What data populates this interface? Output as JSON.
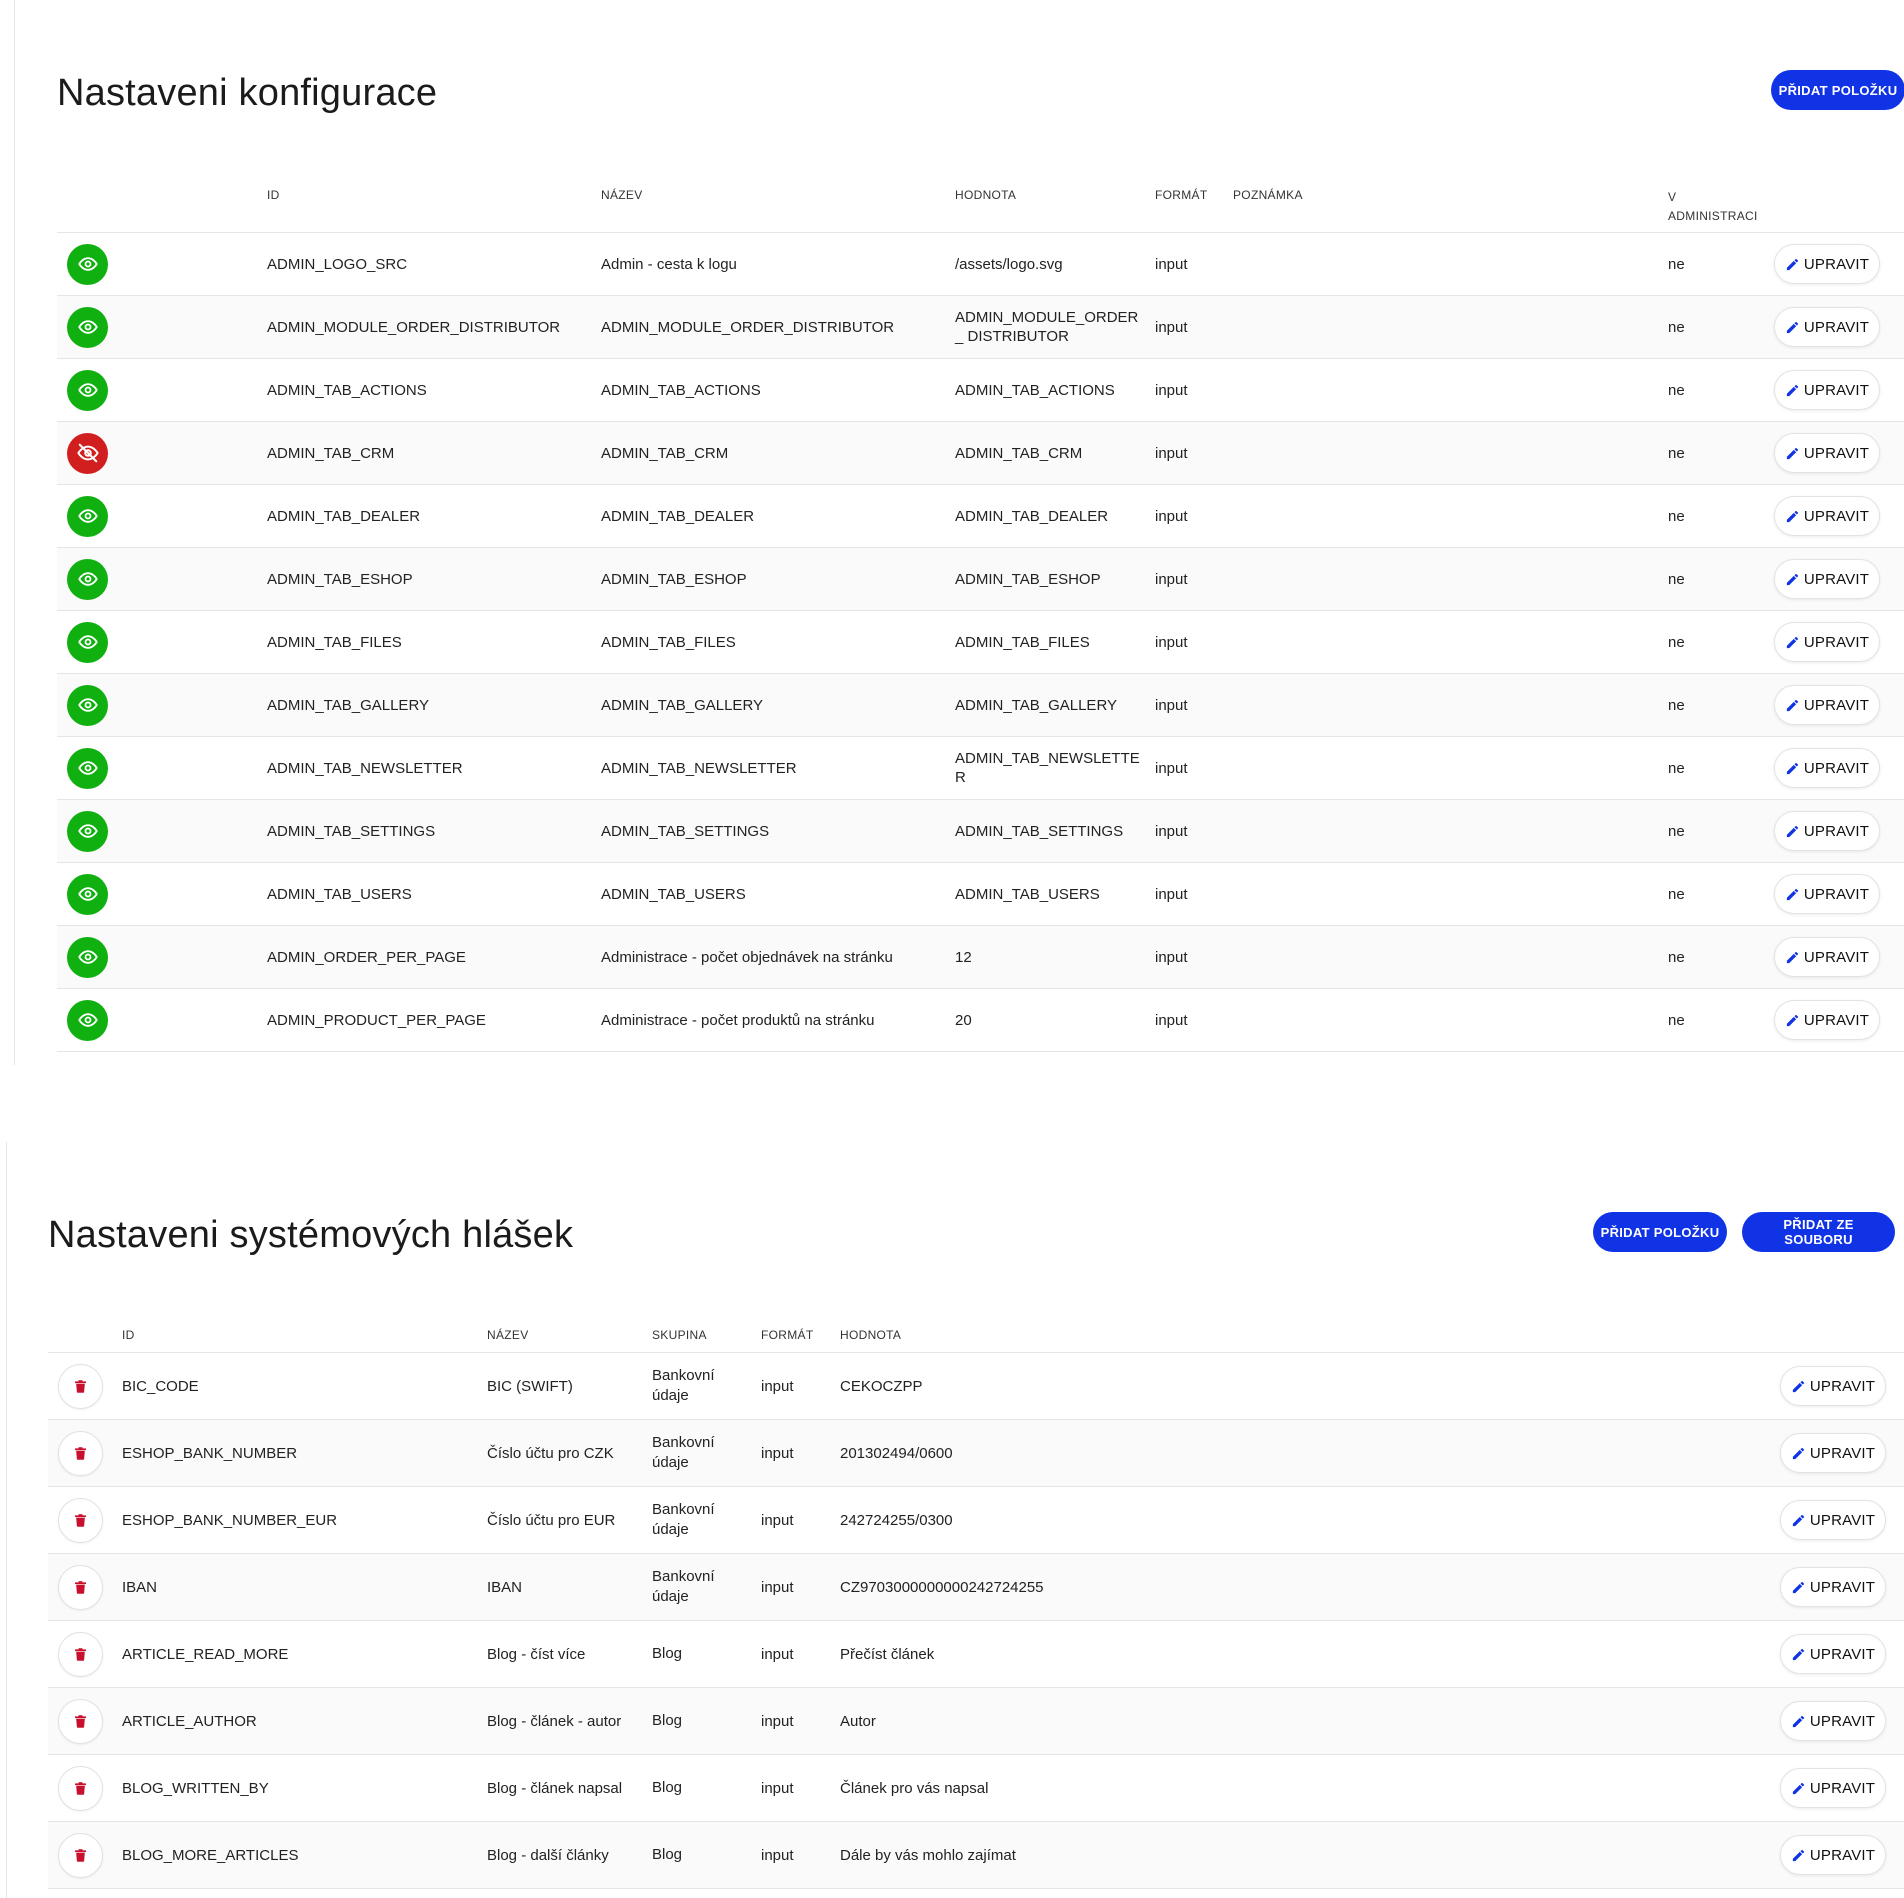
{
  "config": {
    "title": "Nastaveni konfigurace",
    "add_button": "PŘIDAT POLOŽKU",
    "columns": {
      "id": "ID",
      "name": "NÁZEV",
      "value": "HODNOTA",
      "format": "FORMÁT",
      "note": "POZNÁMKA",
      "admin": "V ADMINISTRACI"
    },
    "edit_label": "UPRAVIT",
    "rows": [
      {
        "visible": true,
        "id": "ADMIN_LOGO_SRC",
        "name": "Admin - cesta k logu",
        "value": "/assets/logo.svg",
        "format": "input",
        "note": "",
        "admin": "ne"
      },
      {
        "visible": true,
        "id": "ADMIN_MODULE_ORDER_DISTRIBUTOR",
        "name": "ADMIN_MODULE_ORDER_DISTRIBUTOR",
        "value": "ADMIN_MODULE_ORDER_ DISTRIBUTOR",
        "format": "input",
        "note": "",
        "admin": "ne"
      },
      {
        "visible": true,
        "id": "ADMIN_TAB_ACTIONS",
        "name": "ADMIN_TAB_ACTIONS",
        "value": "ADMIN_TAB_ACTIONS",
        "format": "input",
        "note": "",
        "admin": "ne"
      },
      {
        "visible": false,
        "id": "ADMIN_TAB_CRM",
        "name": "ADMIN_TAB_CRM",
        "value": "ADMIN_TAB_CRM",
        "format": "input",
        "note": "",
        "admin": "ne"
      },
      {
        "visible": true,
        "id": "ADMIN_TAB_DEALER",
        "name": "ADMIN_TAB_DEALER",
        "value": "ADMIN_TAB_DEALER",
        "format": "input",
        "note": "",
        "admin": "ne"
      },
      {
        "visible": true,
        "id": "ADMIN_TAB_ESHOP",
        "name": "ADMIN_TAB_ESHOP",
        "value": "ADMIN_TAB_ESHOP",
        "format": "input",
        "note": "",
        "admin": "ne"
      },
      {
        "visible": true,
        "id": "ADMIN_TAB_FILES",
        "name": "ADMIN_TAB_FILES",
        "value": "ADMIN_TAB_FILES",
        "format": "input",
        "note": "",
        "admin": "ne"
      },
      {
        "visible": true,
        "id": "ADMIN_TAB_GALLERY",
        "name": "ADMIN_TAB_GALLERY",
        "value": "ADMIN_TAB_GALLERY",
        "format": "input",
        "note": "",
        "admin": "ne"
      },
      {
        "visible": true,
        "id": "ADMIN_TAB_NEWSLETTER",
        "name": "ADMIN_TAB_NEWSLETTER",
        "value": "ADMIN_TAB_NEWSLETTE R",
        "format": "input",
        "note": "",
        "admin": "ne"
      },
      {
        "visible": true,
        "id": "ADMIN_TAB_SETTINGS",
        "name": "ADMIN_TAB_SETTINGS",
        "value": "ADMIN_TAB_SETTINGS",
        "format": "input",
        "note": "",
        "admin": "ne"
      },
      {
        "visible": true,
        "id": "ADMIN_TAB_USERS",
        "name": "ADMIN_TAB_USERS",
        "value": "ADMIN_TAB_USERS",
        "format": "input",
        "note": "",
        "admin": "ne"
      },
      {
        "visible": true,
        "id": "ADMIN_ORDER_PER_PAGE",
        "name": "Administrace - počet objednávek na stránku",
        "value": "12",
        "format": "input",
        "note": "",
        "admin": "ne"
      },
      {
        "visible": true,
        "id": "ADMIN_PRODUCT_PER_PAGE",
        "name": "Administrace - počet produktů na stránku",
        "value": "20",
        "format": "input",
        "note": "",
        "admin": "ne"
      }
    ]
  },
  "messages": {
    "title": "Nastaveni systémových hlášek",
    "add_button": "PŘIDAT POLOŽKU",
    "add_from_file_button": "PŘIDAT ZE SOUBORU",
    "columns": {
      "id": "ID",
      "name": "NÁZEV",
      "group": "SKUPINA",
      "format": "FORMÁT",
      "value": "HODNOTA"
    },
    "edit_label": "UPRAVIT",
    "rows": [
      {
        "id": "BIC_CODE",
        "name": "BIC (SWIFT)",
        "group": "Bankovní údaje",
        "format": "input",
        "value": "CEKOCZPP"
      },
      {
        "id": "ESHOP_BANK_NUMBER",
        "name": "Číslo účtu pro CZK",
        "group": "Bankovní údaje",
        "format": "input",
        "value": "201302494/0600"
      },
      {
        "id": "ESHOP_BANK_NUMBER_EUR",
        "name": "Číslo účtu pro EUR",
        "group": "Bankovní údaje",
        "format": "input",
        "value": "242724255/0300"
      },
      {
        "id": "IBAN",
        "name": "IBAN",
        "group": "Bankovní údaje",
        "format": "input",
        "value": "CZ9703000000000242724255"
      },
      {
        "id": "ARTICLE_READ_MORE",
        "name": "Blog - číst více",
        "group": "Blog",
        "format": "input",
        "value": "Přečíst článek"
      },
      {
        "id": "ARTICLE_AUTHOR",
        "name": "Blog - článek - autor",
        "group": "Blog",
        "format": "input",
        "value": "Autor"
      },
      {
        "id": "BLOG_WRITTEN_BY",
        "name": "Blog - článek napsal",
        "group": "Blog",
        "format": "input",
        "value": "Článek pro vás napsal"
      },
      {
        "id": "BLOG_MORE_ARTICLES",
        "name": "Blog - další články",
        "group": "Blog",
        "format": "input",
        "value": "Dále by vás mohlo zajímat"
      }
    ]
  },
  "colors": {
    "primary": "#1033e6",
    "visible": "#10b010",
    "hidden": "#d11f1f",
    "delete": "#c8102e"
  },
  "icons": {
    "visible": "eye-icon",
    "hidden": "eye-off-icon",
    "edit": "pencil-icon",
    "delete": "trash-icon"
  }
}
